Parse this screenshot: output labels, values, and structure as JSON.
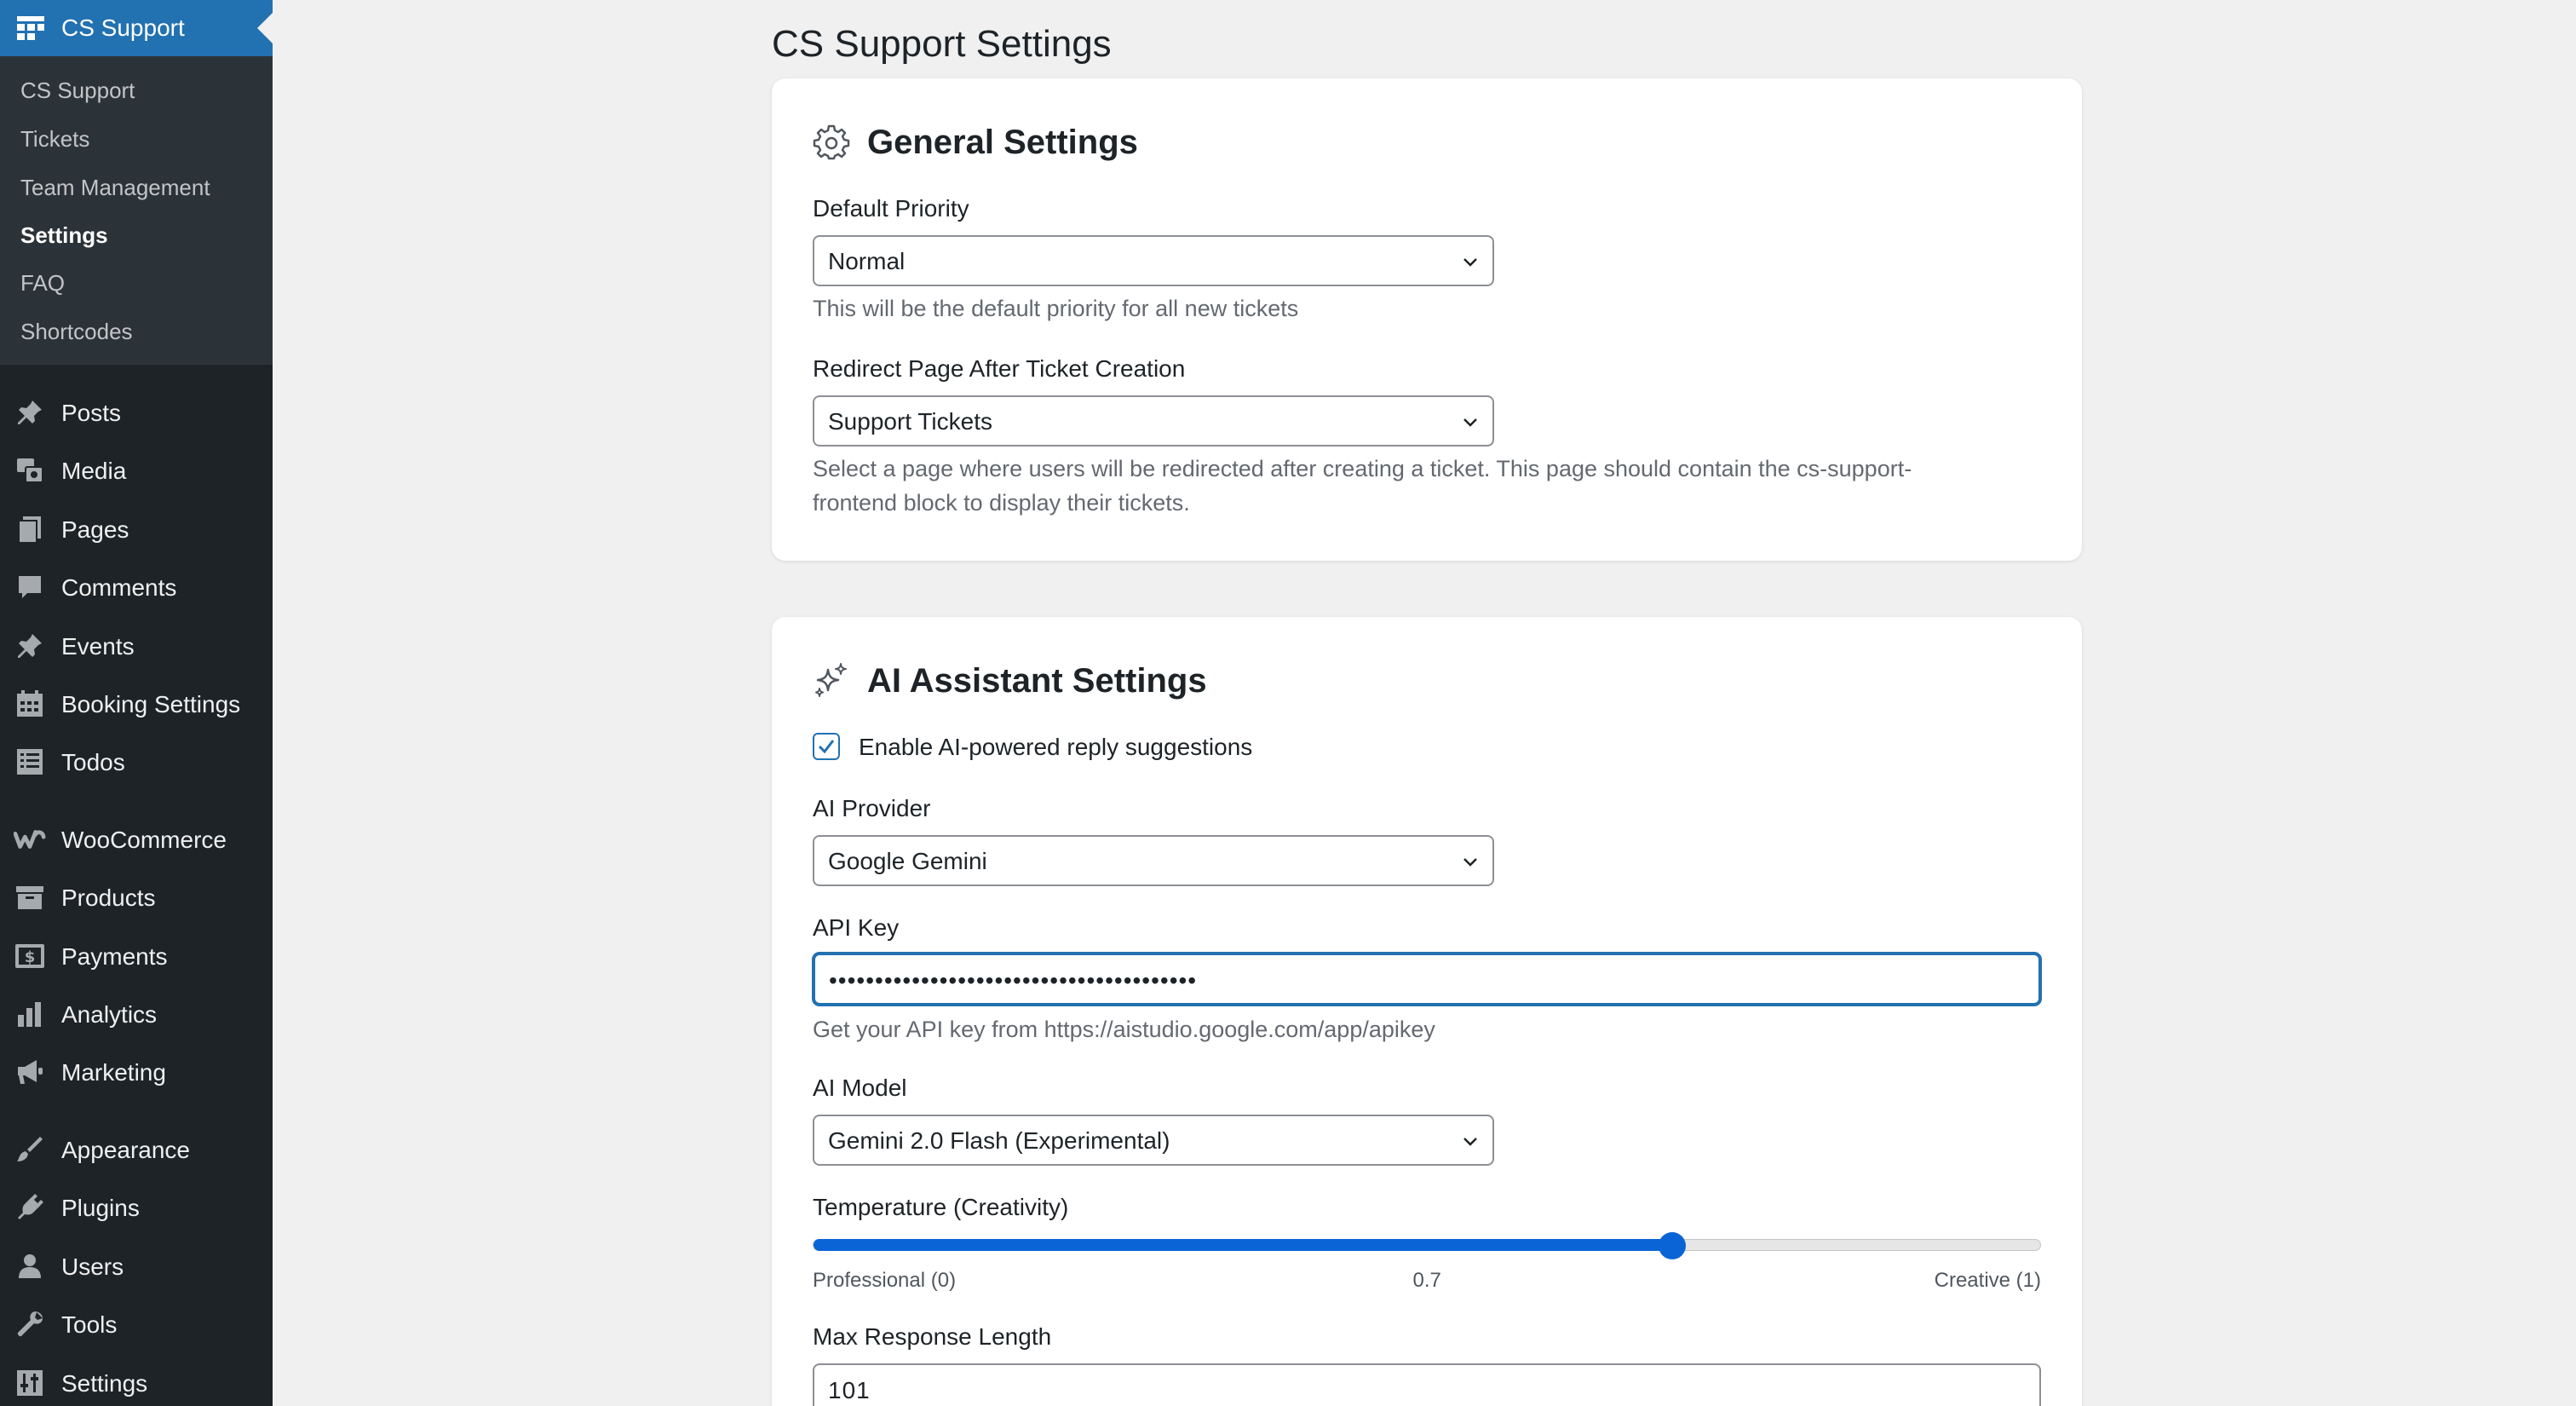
{
  "sidebar": {
    "header": {
      "label": "CS Support",
      "icon": "grid-dashboard-icon"
    },
    "submenu": [
      {
        "label": "CS Support",
        "current": false
      },
      {
        "label": "Tickets",
        "current": false
      },
      {
        "label": "Team Management",
        "current": false
      },
      {
        "label": "Settings",
        "current": true
      },
      {
        "label": "FAQ",
        "current": false
      },
      {
        "label": "Shortcodes",
        "current": false
      }
    ],
    "menu": [
      {
        "label": "Posts",
        "icon": "pushpin-icon"
      },
      {
        "label": "Media",
        "icon": "media-icon"
      },
      {
        "label": "Pages",
        "icon": "pages-icon"
      },
      {
        "label": "Comments",
        "icon": "comment-icon"
      },
      {
        "label": "Events",
        "icon": "pushpin-icon"
      },
      {
        "label": "Booking Settings",
        "icon": "calendar-icon"
      },
      {
        "label": "Todos",
        "icon": "list-icon"
      },
      {
        "label": "WooCommerce",
        "icon": "woocommerce-icon"
      },
      {
        "label": "Products",
        "icon": "archive-box-icon"
      },
      {
        "label": "Payments",
        "icon": "dollar-icon"
      },
      {
        "label": "Analytics",
        "icon": "bar-chart-icon"
      },
      {
        "label": "Marketing",
        "icon": "megaphone-icon"
      },
      {
        "label": "Appearance",
        "icon": "paintbrush-icon"
      },
      {
        "label": "Plugins",
        "icon": "plug-icon"
      },
      {
        "label": "Users",
        "icon": "user-icon"
      },
      {
        "label": "Tools",
        "icon": "wrench-icon"
      },
      {
        "label": "Settings",
        "icon": "settings-sliders-icon"
      }
    ]
  },
  "page": {
    "title": "CS Support Settings",
    "general": {
      "title": "General Settings",
      "default_priority": {
        "label": "Default Priority",
        "value": "Normal",
        "help": "This will be the default priority for all new tickets"
      },
      "redirect_page": {
        "label": "Redirect Page After Ticket Creation",
        "value": "Support Tickets",
        "help_line1": "Select a page where users will be redirected after creating a ticket. This page should contain the cs-support-",
        "help_line2": "frontend block to display their tickets."
      }
    },
    "ai": {
      "title": "AI Assistant Settings",
      "enable": {
        "label": "Enable AI-powered reply suggestions",
        "checked": true
      },
      "provider": {
        "label": "AI Provider",
        "value": "Google Gemini"
      },
      "api_key": {
        "label": "API Key",
        "value": "••••••••••••••••••••••••••••••••••••••••",
        "help": "Get your API key from https://aistudio.google.com/app/apikey"
      },
      "model": {
        "label": "AI Model",
        "value": "Gemini 2.0 Flash (Experimental)"
      },
      "temperature": {
        "label": "Temperature (Creativity)",
        "value": 0.7,
        "value_label": "0.7",
        "min_label": "Professional (0)",
        "max_label": "Creative (1)"
      },
      "max_length": {
        "label": "Max Response Length",
        "value": "101"
      }
    }
  },
  "colors": {
    "sidebar_bg": "#1d2327",
    "sidebar_sub_bg": "#2c3338",
    "accent": "#2271b1",
    "slider": "#0a64d6",
    "page_bg": "#f0f0f1"
  }
}
